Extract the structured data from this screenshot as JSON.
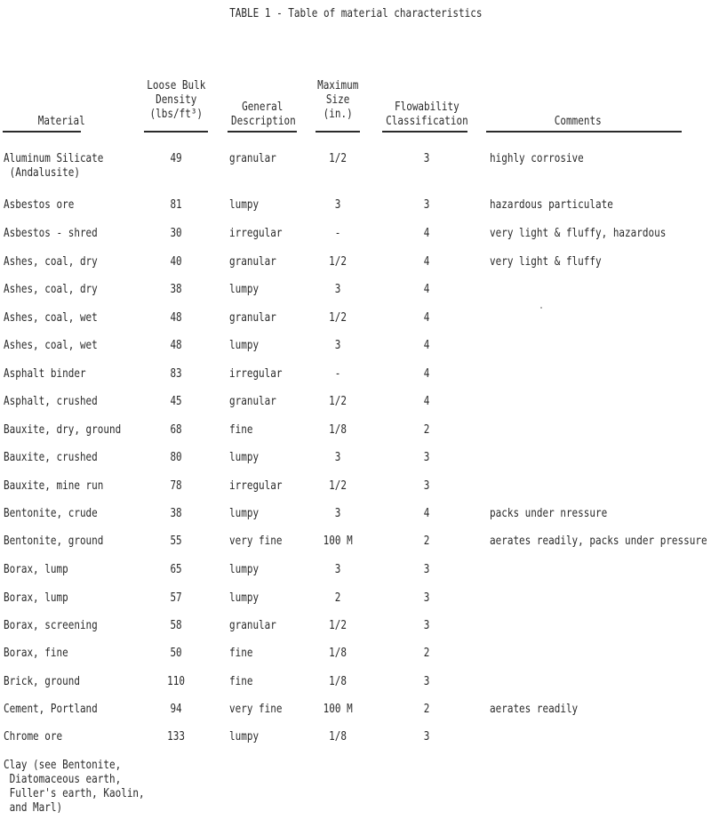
{
  "title": "TABLE 1 - Table of material characteristics",
  "columns": {
    "material": [
      "",
      "",
      "Material"
    ],
    "density": [
      "Loose Bulk",
      "Density",
      "(lbs/ft³)"
    ],
    "description": [
      "",
      "General",
      "Description"
    ],
    "size": [
      "Maximum",
      "Size",
      "(in.)"
    ],
    "flowability": [
      "",
      "Flowability",
      "Classification"
    ],
    "comments": [
      "",
      "",
      "Comments"
    ]
  },
  "rows": [
    {
      "material": "Aluminum Silicate\n (Andalusite)",
      "density": "49",
      "description": "granular",
      "size": "1/2",
      "flowability": "3",
      "comments": "highly corrosive"
    },
    {
      "material": "Asbestos ore",
      "density": "81",
      "description": "lumpy",
      "size": "3",
      "flowability": "3",
      "comments": "hazardous particulate"
    },
    {
      "material": "Asbestos - shred",
      "density": "30",
      "description": "irregular",
      "size": "-",
      "flowability": "4",
      "comments": "very light & fluffy, hazardous"
    },
    {
      "material": "Ashes, coal, dry",
      "density": "40",
      "description": "granular",
      "size": "1/2",
      "flowability": "4",
      "comments": "very light & fluffy"
    },
    {
      "material": "Ashes, coal, dry",
      "density": "38",
      "description": "lumpy",
      "size": "3",
      "flowability": "4",
      "comments": ""
    },
    {
      "material": "Ashes, coal, wet",
      "density": "48",
      "description": "granular",
      "size": "1/2",
      "flowability": "4",
      "comments": ""
    },
    {
      "material": "Ashes, coal, wet",
      "density": "48",
      "description": "lumpy",
      "size": "3",
      "flowability": "4",
      "comments": ""
    },
    {
      "material": "Asphalt binder",
      "density": "83",
      "description": "irregular",
      "size": "-",
      "flowability": "4",
      "comments": ""
    },
    {
      "material": "Asphalt, crushed",
      "density": "45",
      "description": "granular",
      "size": "1/2",
      "flowability": "4",
      "comments": ""
    },
    {
      "material": "Bauxite, dry, ground",
      "density": "68",
      "description": "fine",
      "size": "1/8",
      "flowability": "2",
      "comments": ""
    },
    {
      "material": "Bauxite, crushed",
      "density": "80",
      "description": "lumpy",
      "size": "3",
      "flowability": "3",
      "comments": ""
    },
    {
      "material": "Bauxite, mine run",
      "density": "78",
      "description": "irregular",
      "size": "1/2",
      "flowability": "3",
      "comments": ""
    },
    {
      "material": "Bentonite, crude",
      "density": "38",
      "description": "lumpy",
      "size": "3",
      "flowability": "4",
      "comments": "packs under nressure"
    },
    {
      "material": "Bentonite, ground",
      "density": "55",
      "description": "very fine",
      "size": "100 M",
      "flowability": "2",
      "comments": "aerates readily, packs under pressure"
    },
    {
      "material": "Borax, lump",
      "density": "65",
      "description": "lumpy",
      "size": "3",
      "flowability": "3",
      "comments": ""
    },
    {
      "material": "Borax, lump",
      "density": "57",
      "description": "lumpy",
      "size": "2",
      "flowability": "3",
      "comments": ""
    },
    {
      "material": "Borax, screening",
      "density": "58",
      "description": "granular",
      "size": "1/2",
      "flowability": "3",
      "comments": ""
    },
    {
      "material": "Borax, fine",
      "density": "50",
      "description": "fine",
      "size": "1/8",
      "flowability": "2",
      "comments": ""
    },
    {
      "material": "Brick, ground",
      "density": "110",
      "description": "fine",
      "size": "1/8",
      "flowability": "3",
      "comments": ""
    },
    {
      "material": "Cement, Portland",
      "density": "94",
      "description": "very fine",
      "size": "100 M",
      "flowability": "2",
      "comments": "aerates readily"
    },
    {
      "material": "Chrome ore",
      "density": "133",
      "description": "lumpy",
      "size": "1/8",
      "flowability": "3",
      "comments": ""
    },
    {
      "material": "Clay (see Bentonite,\n Diatomaceous earth,\n Fuller's earth, Kaolin,\n and Marl)",
      "density": "",
      "description": "",
      "size": "",
      "flowability": "",
      "comments": ""
    }
  ]
}
